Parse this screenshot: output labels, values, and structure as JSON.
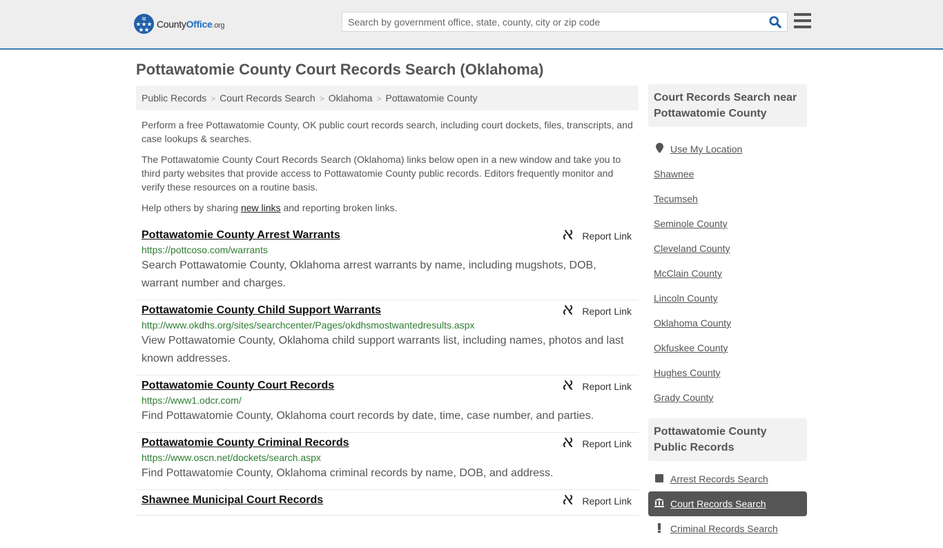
{
  "header": {
    "logo": {
      "county": "County",
      "office": "Office",
      "org": ".org"
    },
    "search_placeholder": "Search by government office, state, county, city or zip code"
  },
  "page_title": "Pottawatomie County Court Records Search (Oklahoma)",
  "breadcrumb": [
    "Public Records",
    "Court Records Search",
    "Oklahoma",
    "Pottawatomie County"
  ],
  "breadcrumb_sep": ">",
  "intro": {
    "p1": "Perform a free Pottawatomie County, OK public court records search, including court dockets, files, transcripts, and case lookups & searches.",
    "p2": "The Pottawatomie County Court Records Search (Oklahoma) links below open in a new window and take you to third party websites that provide access to Pottawatomie County public records. Editors frequently monitor and verify these resources on a routine basis.",
    "p3_before": "Help others by sharing ",
    "p3_link": "new links",
    "p3_after": " and reporting broken links."
  },
  "report_label": "Report Link",
  "results": [
    {
      "title": "Pottawatomie County Arrest Warrants",
      "url": "https://pottcoso.com/warrants",
      "desc": "Search Pottawatomie County, Oklahoma arrest warrants by name, including mugshots, DOB, warrant number and charges."
    },
    {
      "title": "Pottawatomie County Child Support Warrants",
      "url": "http://www.okdhs.org/sites/searchcenter/Pages/okdhsmostwantedresults.aspx",
      "desc": "View Pottawatomie County, Oklahoma child support warrants list, including names, photos and last known addresses."
    },
    {
      "title": "Pottawatomie County Court Records",
      "url": "https://www1.odcr.com/",
      "desc": "Find Pottawatomie County, Oklahoma court records by date, time, case number, and parties."
    },
    {
      "title": "Pottawatomie County Criminal Records",
      "url": "https://www.oscn.net/dockets/search.aspx",
      "desc": "Find Pottawatomie County, Oklahoma criminal records by name, DOB, and address."
    },
    {
      "title": "Shawnee Municipal Court Records",
      "url": "",
      "desc": ""
    }
  ],
  "sidebar": {
    "nearby_title": "Court Records Search near Pottawatomie County",
    "use_location": "Use My Location",
    "nearby": [
      "Shawnee",
      "Tecumseh",
      "Seminole County",
      "Cleveland County",
      "McClain County",
      "Lincoln County",
      "Oklahoma County",
      "Okfuskee County",
      "Hughes County",
      "Grady County"
    ],
    "public_title": "Pottawatomie County Public Records",
    "public_items": [
      {
        "label": "Arrest Records Search",
        "icon": "square-icon",
        "active": false
      },
      {
        "label": "Court Records Search",
        "icon": "courthouse-icon",
        "active": true
      },
      {
        "label": "Criminal Records Search",
        "icon": "exclamation-icon",
        "active": false
      }
    ]
  }
}
